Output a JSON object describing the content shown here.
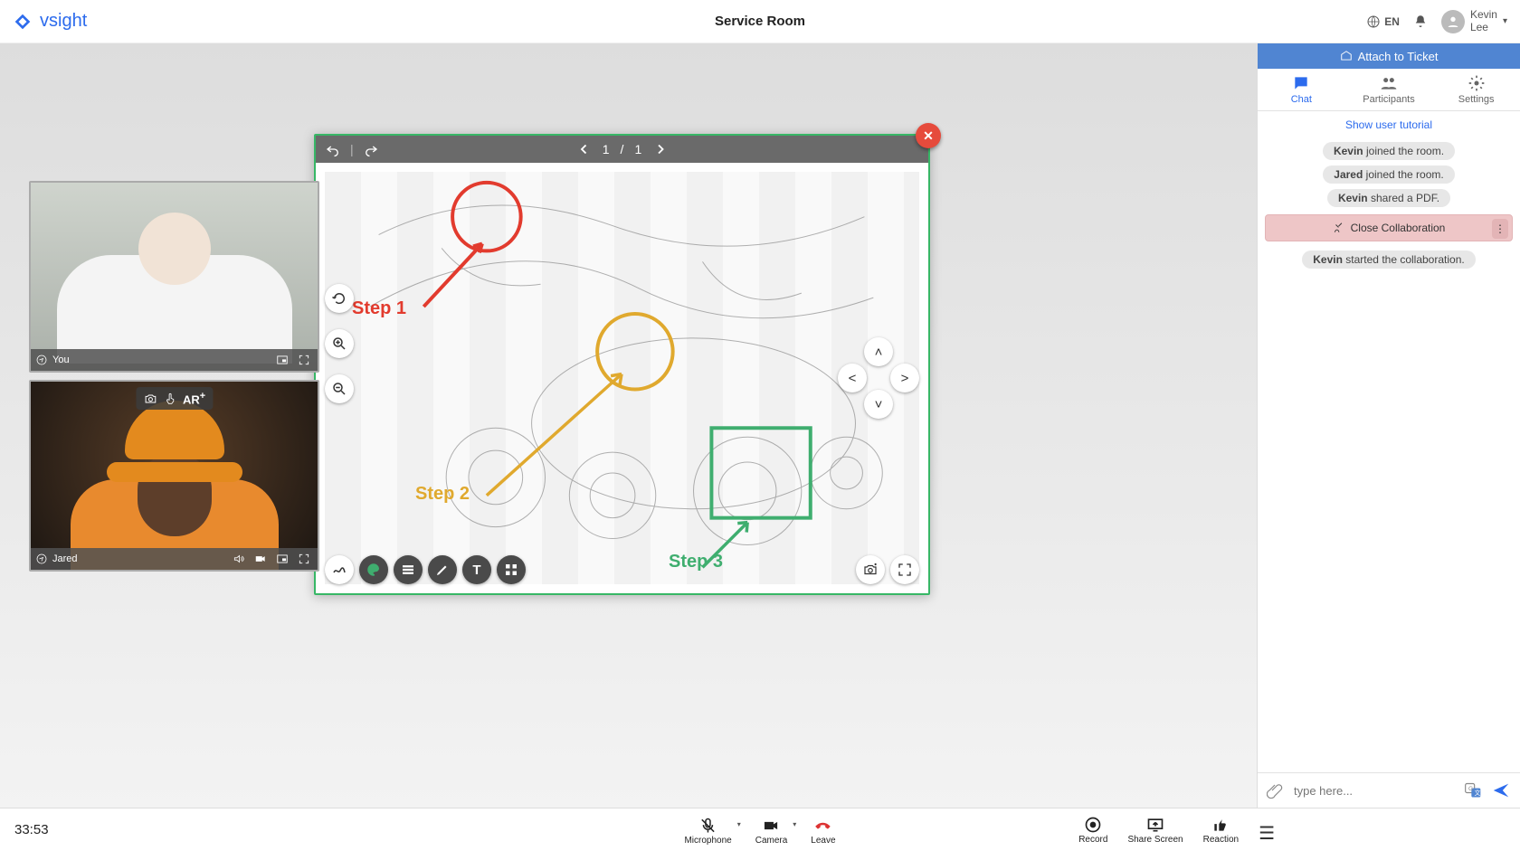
{
  "header": {
    "brand": "vsight",
    "title": "Service Room",
    "language": "EN",
    "user_first": "Kevin",
    "user_last": "Lee"
  },
  "videos": {
    "you_label": "You",
    "jared_label": "Jared",
    "ar_label": "AR"
  },
  "viewer": {
    "page_current": "1",
    "page_sep": "/",
    "page_total": "1",
    "step1": "Step 1",
    "step2": "Step 2",
    "step3": "Step 3"
  },
  "side": {
    "attach": "Attach to Ticket",
    "tab_chat": "Chat",
    "tab_participants": "Participants",
    "tab_settings": "Settings",
    "tutorial": "Show user tutorial",
    "ev1_user": "Kevin",
    "ev1_text": "joined the room.",
    "ev2_user": "Jared",
    "ev2_text": "joined the room.",
    "ev3_user": "Kevin",
    "ev3_text": "shared a PDF.",
    "close_collab": "Close Collaboration",
    "ev4_user": "Kevin",
    "ev4_text": "started the collaboration.",
    "chat_placeholder": "type here..."
  },
  "footer": {
    "timer": "33:53",
    "mic": "Microphone",
    "cam": "Camera",
    "leave": "Leave",
    "record": "Record",
    "share": "Share Screen",
    "reaction": "Reaction"
  }
}
